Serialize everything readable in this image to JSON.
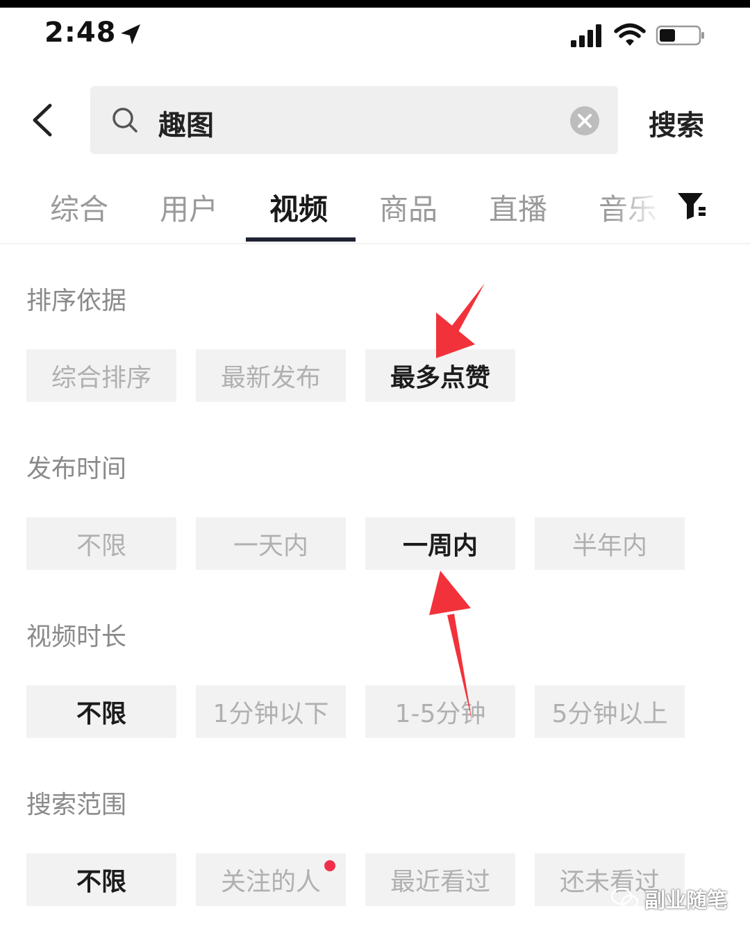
{
  "status_bar": {
    "time": "2:48"
  },
  "search": {
    "query": "趣图",
    "button_label": "搜索"
  },
  "tabs": [
    {
      "label": "综合",
      "active": false
    },
    {
      "label": "用户",
      "active": false
    },
    {
      "label": "视频",
      "active": true
    },
    {
      "label": "商品",
      "active": false
    },
    {
      "label": "直播",
      "active": false
    },
    {
      "label": "音乐",
      "active": false
    }
  ],
  "filters": {
    "sort": {
      "title": "排序依据",
      "options": [
        {
          "label": "综合排序",
          "selected": false
        },
        {
          "label": "最新发布",
          "selected": false
        },
        {
          "label": "最多点赞",
          "selected": true
        }
      ]
    },
    "publish_time": {
      "title": "发布时间",
      "options": [
        {
          "label": "不限",
          "selected": false
        },
        {
          "label": "一天内",
          "selected": false
        },
        {
          "label": "一周内",
          "selected": true
        },
        {
          "label": "半年内",
          "selected": false
        }
      ]
    },
    "duration": {
      "title": "视频时长",
      "options": [
        {
          "label": "不限",
          "selected": true
        },
        {
          "label": "1分钟以下",
          "selected": false
        },
        {
          "label": "1-5分钟",
          "selected": false
        },
        {
          "label": "5分钟以上",
          "selected": false
        }
      ]
    },
    "scope": {
      "title": "搜索范围",
      "options": [
        {
          "label": "不限",
          "selected": true
        },
        {
          "label": "关注的人",
          "selected": false,
          "badge_dot": true
        },
        {
          "label": "最近看过",
          "selected": false
        },
        {
          "label": "还未看过",
          "selected": false
        }
      ]
    }
  },
  "watermark": {
    "text": "副业随笔"
  },
  "colors": {
    "annotation_arrow": "#f2323a",
    "badge_dot": "#f0304a",
    "tab_underline": "#1f2233"
  },
  "icons": [
    "location-arrow-icon",
    "signal-icon",
    "wifi-icon",
    "battery-icon",
    "back-icon",
    "search-icon",
    "clear-icon",
    "filter-icon",
    "wechat-icon"
  ]
}
